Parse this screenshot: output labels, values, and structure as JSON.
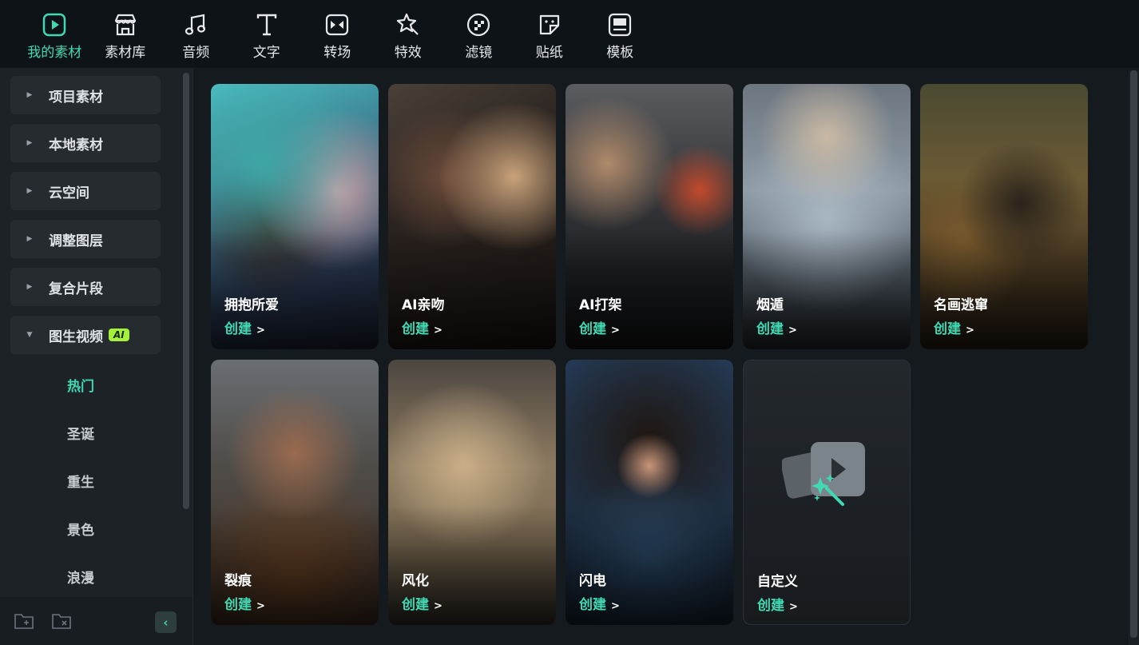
{
  "toolbar": {
    "tabs": [
      {
        "label": "我的素材",
        "icon": "my-media-icon",
        "active": true
      },
      {
        "label": "素材库",
        "icon": "stock-store-icon"
      },
      {
        "label": "音频",
        "icon": "music-note-icon"
      },
      {
        "label": "文字",
        "icon": "text-icon"
      },
      {
        "label": "转场",
        "icon": "transition-icon"
      },
      {
        "label": "特效",
        "icon": "effects-star-icon"
      },
      {
        "label": "滤镜",
        "icon": "filter-icon"
      },
      {
        "label": "贴纸",
        "icon": "sticker-icon"
      },
      {
        "label": "模板",
        "icon": "template-icon"
      }
    ]
  },
  "sidebar": {
    "items": [
      {
        "label": "项目素材"
      },
      {
        "label": "本地素材"
      },
      {
        "label": "云空间"
      },
      {
        "label": "调整图层"
      },
      {
        "label": "复合片段"
      },
      {
        "label": "图生视频",
        "badge": "AI",
        "expanded": true
      }
    ],
    "subitems": [
      {
        "label": "热门",
        "active": true
      },
      {
        "label": "圣诞"
      },
      {
        "label": "重生"
      },
      {
        "label": "景色"
      },
      {
        "label": "浪漫"
      }
    ]
  },
  "cards": [
    {
      "title": "拥抱所爱",
      "action": "创建"
    },
    {
      "title": "AI亲吻",
      "action": "创建"
    },
    {
      "title": "AI打架",
      "action": "创建"
    },
    {
      "title": "烟遁",
      "action": "创建"
    },
    {
      "title": "名画逃窜",
      "action": "创建"
    },
    {
      "title": "裂痕",
      "action": "创建"
    },
    {
      "title": "风化",
      "action": "创建"
    },
    {
      "title": "闪电",
      "action": "创建"
    },
    {
      "title": "自定义",
      "action": "创建"
    }
  ],
  "colors": {
    "accent": "#41d9b4",
    "badge": "#a4f03a",
    "background": "#151a1e"
  }
}
